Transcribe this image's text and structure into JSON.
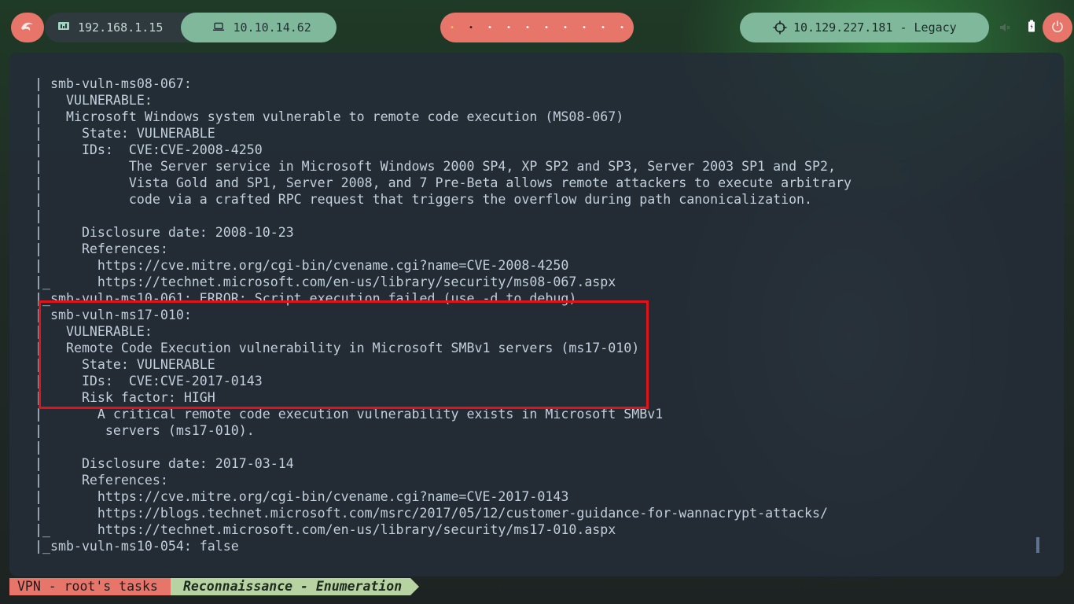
{
  "topbar": {
    "menu_icon": "kali-dragon-icon",
    "local_ip": "192.168.1.15",
    "local_ip_icon": "network-icon",
    "vpn_ip": "10.10.14.62",
    "vpn_ip_icon": "laptop-icon",
    "workspaces": [
      "•",
      "•",
      "•",
      "•",
      "•",
      "•",
      "•",
      "•",
      "•",
      "•"
    ],
    "active_workspace": 2,
    "target": "10.129.227.181 - Legacy",
    "target_icon": "crosshair-icon",
    "tray_icons": [
      "volume-muted-icon",
      "battery-icon"
    ],
    "power_icon": "power-icon"
  },
  "terminal": {
    "lines": [
      "| smb-vuln-ms08-067:",
      "|   VULNERABLE:",
      "|   Microsoft Windows system vulnerable to remote code execution (MS08-067)",
      "|     State: VULNERABLE",
      "|     IDs:  CVE:CVE-2008-4250",
      "|           The Server service in Microsoft Windows 2000 SP4, XP SP2 and SP3, Server 2003 SP1 and SP2,",
      "|           Vista Gold and SP1, Server 2008, and 7 Pre-Beta allows remote attackers to execute arbitrary",
      "|           code via a crafted RPC request that triggers the overflow during path canonicalization.",
      "|",
      "|     Disclosure date: 2008-10-23",
      "|     References:",
      "|       https://cve.mitre.org/cgi-bin/cvename.cgi?name=CVE-2008-4250",
      "|_      https://technet.microsoft.com/en-us/library/security/ms08-067.aspx",
      "|_smb-vuln-ms10-061: ERROR: Script execution failed (use -d to debug)",
      "| smb-vuln-ms17-010:",
      "|   VULNERABLE:",
      "|   Remote Code Execution vulnerability in Microsoft SMBv1 servers (ms17-010)",
      "|     State: VULNERABLE",
      "|     IDs:  CVE:CVE-2017-0143",
      "|     Risk factor: HIGH",
      "|       A critical remote code execution vulnerability exists in Microsoft SMBv1",
      "|        servers (ms17-010).",
      "|",
      "|     Disclosure date: 2017-03-14",
      "|     References:",
      "|       https://cve.mitre.org/cgi-bin/cvename.cgi?name=CVE-2017-0143",
      "|       https://blogs.technet.microsoft.com/msrc/2017/05/12/customer-guidance-for-wannacrypt-attacks/",
      "|_      https://technet.microsoft.com/en-us/library/security/ms17-010.aspx",
      "|_smb-vuln-ms10-054: false"
    ],
    "highlight_color": "#e0121a"
  },
  "statusline": {
    "session": "VPN - root's tasks",
    "window": "Reconnaissance - Enumeration"
  }
}
